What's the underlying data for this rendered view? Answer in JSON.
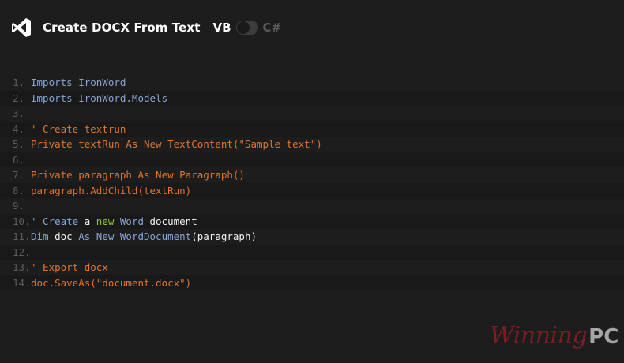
{
  "header": {
    "logo_icon": "visual-studio-icon",
    "title": "Create DOCX From Text",
    "lang_vb": "VB",
    "lang_cs": "C#",
    "toggle_state": "vb"
  },
  "code": {
    "lines": [
      {
        "num": "1.",
        "tokens": [
          {
            "t": "Imports IronWord",
            "c": "blue"
          }
        ]
      },
      {
        "num": "2.",
        "tokens": [
          {
            "t": "Imports IronWord.Models",
            "c": "blue"
          }
        ]
      },
      {
        "num": "3.",
        "tokens": []
      },
      {
        "num": "4.",
        "tokens": [
          {
            "t": "' Create textrun",
            "c": "orange"
          }
        ]
      },
      {
        "num": "5.",
        "tokens": [
          {
            "t": "Private textRun As New TextContent(\"Sample text\")",
            "c": "orange"
          }
        ]
      },
      {
        "num": "6.",
        "tokens": []
      },
      {
        "num": "7.",
        "tokens": [
          {
            "t": "Private paragraph As New Paragraph()",
            "c": "orange"
          }
        ]
      },
      {
        "num": "8.",
        "tokens": [
          {
            "t": "paragraph.AddChild(textRun)",
            "c": "orange"
          }
        ]
      },
      {
        "num": "9.",
        "tokens": []
      },
      {
        "num": "10.",
        "tokens": [
          {
            "t": "' Create ",
            "c": "blue"
          },
          {
            "t": "a ",
            "c": "white"
          },
          {
            "t": "new",
            "c": "green"
          },
          {
            "t": " Word ",
            "c": "blue"
          },
          {
            "t": "document",
            "c": "white"
          }
        ]
      },
      {
        "num": "11.",
        "tokens": [
          {
            "t": "Dim ",
            "c": "blue"
          },
          {
            "t": "doc ",
            "c": "white"
          },
          {
            "t": "As New WordDocument",
            "c": "blue"
          },
          {
            "t": "(paragraph)",
            "c": "white"
          }
        ]
      },
      {
        "num": "12.",
        "tokens": []
      },
      {
        "num": "13.",
        "tokens": [
          {
            "t": "' Export docx",
            "c": "orange"
          }
        ]
      },
      {
        "num": "14.",
        "tokens": [
          {
            "t": "doc.SaveAs(\"document.docx\")",
            "c": "orange"
          }
        ]
      }
    ]
  },
  "watermark": {
    "script": "Winning",
    "suffix": "PC"
  },
  "colors": {
    "background": "#1d1d1d",
    "keyword_blue": "#86a5d2",
    "string_orange": "#e0752b",
    "new_green": "#8fc23b",
    "line_number": "#5c5c5c"
  }
}
